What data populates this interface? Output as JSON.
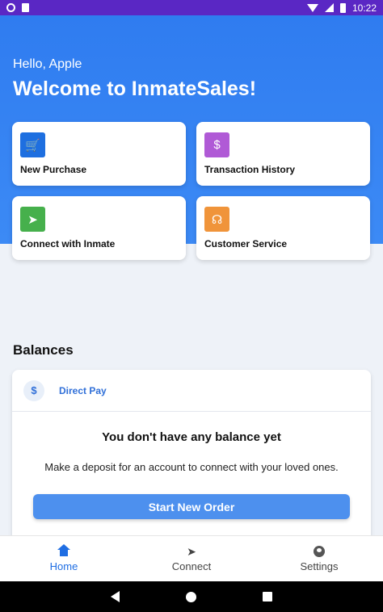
{
  "status_bar": {
    "time": "10:22"
  },
  "hero": {
    "greeting": "Hello, Apple",
    "welcome": "Welcome to InmateSales!"
  },
  "tiles": [
    {
      "label": "New Purchase",
      "icon": "cart-icon",
      "color": "#1e6fe0"
    },
    {
      "label": "Transaction History",
      "icon": "receipt-icon",
      "color": "#b05ad6"
    },
    {
      "label": "Connect with Inmate",
      "icon": "send-icon",
      "color": "#46b04c"
    },
    {
      "label": "Customer Service",
      "icon": "headset-icon",
      "color": "#f0943a"
    }
  ],
  "balances": {
    "title": "Balances",
    "account_label": "Direct Pay",
    "empty_title": "You don't have any balance yet",
    "empty_subtitle": "Make a deposit for an account to connect with your loved ones.",
    "button_label": "Start New Order"
  },
  "bottom_nav": [
    {
      "label": "Home",
      "icon": "home-icon",
      "active": true
    },
    {
      "label": "Connect",
      "icon": "send-icon",
      "active": false
    },
    {
      "label": "Settings",
      "icon": "settings-icon",
      "active": false
    }
  ],
  "colors": {
    "primary": "#2f7cf0",
    "button": "#4d90ee",
    "status_bar": "#5a27c4"
  }
}
